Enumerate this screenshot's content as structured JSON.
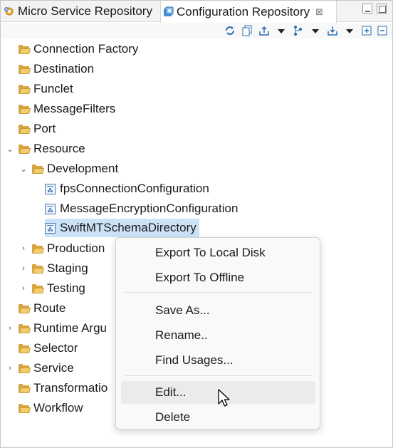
{
  "tabs": [
    {
      "label": "Micro Service Repository",
      "active": false
    },
    {
      "label": "Configuration Repository",
      "active": true
    }
  ],
  "tab_close_glyph": "⊠",
  "toolbar": {
    "icons": [
      "refresh-icon",
      "copy-icon",
      "export-icon",
      "dropdown-arrow",
      "branch-icon",
      "dropdown-arrow",
      "import-icon",
      "dropdown-arrow",
      "expand-all-icon",
      "collapse-all-icon"
    ]
  },
  "tree": [
    {
      "label": "Connection Factory",
      "expanded": false,
      "has_children": false
    },
    {
      "label": "Destination",
      "expanded": false,
      "has_children": false
    },
    {
      "label": "Funclet",
      "expanded": false,
      "has_children": false
    },
    {
      "label": "MessageFilters",
      "expanded": false,
      "has_children": false
    },
    {
      "label": "Port",
      "expanded": false,
      "has_children": false
    },
    {
      "label": "Resource",
      "expanded": true,
      "has_children": true
    },
    {
      "label": "Development",
      "expanded": true,
      "has_children": true
    },
    {
      "label": "fpsConnectionConfiguration",
      "type": "file"
    },
    {
      "label": "MessageEncryptionConfiguration",
      "type": "file"
    },
    {
      "label": "SwiftMTSchemaDirectory",
      "type": "file",
      "selected": true
    },
    {
      "label": "Production",
      "expanded": false,
      "has_children": true
    },
    {
      "label": "Staging",
      "expanded": false,
      "has_children": true
    },
    {
      "label": "Testing",
      "expanded": false,
      "has_children": true
    },
    {
      "label": "Route",
      "expanded": false,
      "has_children": false
    },
    {
      "label": "Runtime Argu",
      "expanded": false,
      "has_children": true
    },
    {
      "label": "Selector",
      "expanded": false,
      "has_children": false
    },
    {
      "label": "Service",
      "expanded": false,
      "has_children": true
    },
    {
      "label": "Transformatio",
      "expanded": false,
      "has_children": false
    },
    {
      "label": "Workflow",
      "expanded": false,
      "has_children": false
    }
  ],
  "context_menu": {
    "items": [
      {
        "label": "Export To Local Disk"
      },
      {
        "label": "Export To Offline"
      },
      {
        "label": "Save As..."
      },
      {
        "label": "Rename.."
      },
      {
        "label": "Find Usages..."
      },
      {
        "label": "Edit...",
        "hover": true
      },
      {
        "label": "Delete"
      }
    ]
  },
  "colors": {
    "selection": "#cce3f7",
    "folder": "#f3cd6c",
    "menu_hover": "#ebebeb"
  }
}
